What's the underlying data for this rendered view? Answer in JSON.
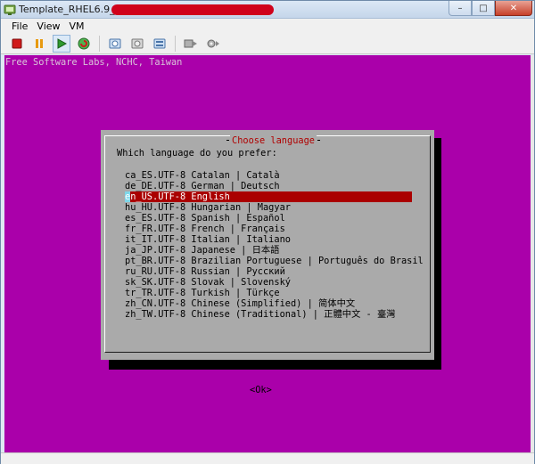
{
  "window": {
    "title": "Template_RHEL6.9_OS_x64",
    "controls": {
      "minimize": "–",
      "maximize": "□",
      "close": "✕"
    }
  },
  "menubar": {
    "items": [
      "File",
      "View",
      "VM"
    ]
  },
  "toolbar": {
    "buttons": [
      "stop",
      "pause",
      "play",
      "reset",
      "snapshot-take",
      "snapshot-revert",
      "snapshot-manager",
      "send-ctrl-alt-del",
      "settings"
    ]
  },
  "console": {
    "backtitle": "Free Software Labs, NCHC, Taiwan",
    "dialog": {
      "title": "Choose language",
      "prompt": "Which language do you prefer:",
      "selected_index": 2,
      "languages": [
        "ca_ES.UTF-8 Catalan | Català",
        "de_DE.UTF-8 German | Deutsch",
        "en_US.UTF-8 English",
        "hu_HU.UTF-8 Hungarian | Magyar",
        "es_ES.UTF-8 Spanish | Español",
        "fr_FR.UTF-8 French | Français",
        "it_IT.UTF-8 Italian | Italiano",
        "ja_JP.UTF-8 Japanese | 日本語",
        "pt_BR.UTF-8 Brazilian Portuguese | Português do Brasil",
        "ru_RU.UTF-8 Russian | Русский",
        "sk_SK.UTF-8 Slovak | Slovenský",
        "tr_TR.UTF-8 Turkish | Türkçe",
        "zh_CN.UTF-8 Chinese (Simplified) | 简体中文",
        "zh_TW.UTF-8 Chinese (Traditional) | 正體中文 - 臺灣"
      ],
      "ok_label": "<Ok>"
    },
    "colors": {
      "background": "#aa00aa",
      "dialog": "#aaaaaa",
      "title": "#b00000",
      "selection": "#aa0000",
      "cursor": "#7fd6e8"
    }
  }
}
